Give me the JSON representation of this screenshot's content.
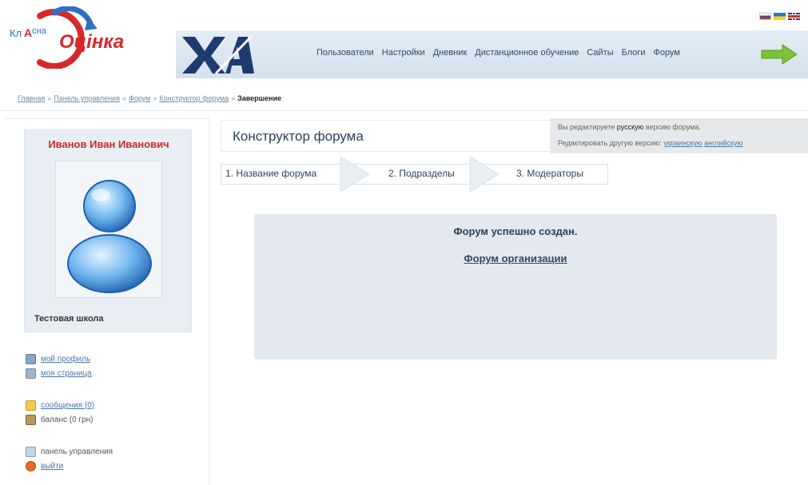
{
  "header": {
    "logo_text": "Класна Оцінка",
    "logo_colors": {
      "blue": "#2f6ec4",
      "red": "#d6282b"
    },
    "nav": [
      "Пользователи",
      "Настройки",
      "Дневник",
      "Дистанционное обучение",
      "Сайты",
      "Блоги",
      "Форум"
    ],
    "flags": [
      "ru",
      "ua",
      "uk"
    ]
  },
  "breadcrumb": {
    "items": [
      "Главная",
      "Панель управления",
      "Форум",
      "Конструктор форума"
    ],
    "separator": "»",
    "current": "Завершение"
  },
  "sidebar": {
    "user_name": "Иванов Иван Иванович",
    "school": "Тестовая школа",
    "links": [
      {
        "label": "мой профиль",
        "icon": "profile-icon"
      },
      {
        "label": "моя страница",
        "icon": "page-icon"
      },
      {
        "label": "сообщения (0)",
        "icon": "mail-icon"
      },
      {
        "label": "баланс (0 грн)",
        "icon": "wallet-icon"
      },
      {
        "label": "панель управления",
        "icon": "panel-icon"
      },
      {
        "label": "выйти",
        "icon": "exit-icon"
      }
    ]
  },
  "main": {
    "title": "Конструктор форума",
    "edit_notice": {
      "prefix": "Вы редактируете",
      "lang": "русскую",
      "suffix": "версию форума.",
      "other_prefix": "Редактировать другую версию:",
      "other_langs": [
        "украинскую",
        "английскую"
      ]
    },
    "steps": [
      "1. Название форума",
      "2. Подразделы",
      "3. Модераторы"
    ],
    "success_message": "Форум успешно создан.",
    "forum_link": "Форум организации"
  },
  "colors": {
    "accent": "#2b4259",
    "name_red": "#cc2b2b",
    "panel_bg": "#e3e9ef",
    "link": "#4a78a8"
  }
}
